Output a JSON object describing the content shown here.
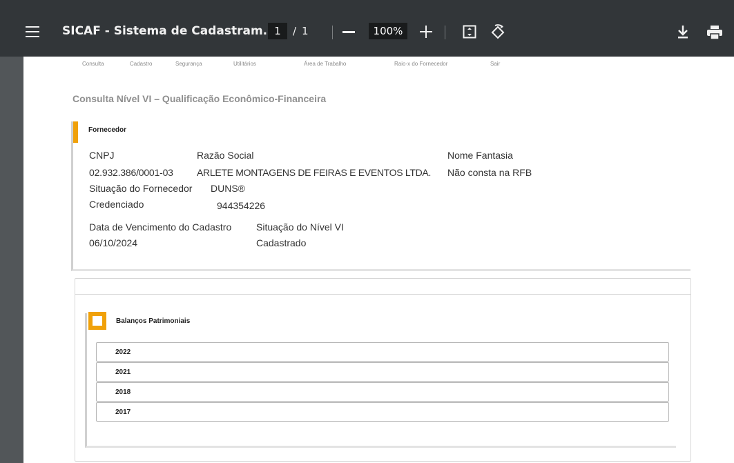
{
  "toolbar": {
    "title": "SICAF - Sistema de Cadastram...",
    "page_current": "1",
    "page_separator": "/",
    "page_total": "1",
    "zoom": "100%",
    "icons": [
      "menu-icon",
      "zoom-out-icon",
      "zoom-in-icon",
      "fit-page-icon",
      "rotate-icon",
      "download-icon",
      "print-icon"
    ]
  },
  "nav": [
    "Consulta",
    "Cadastro",
    "Segurança",
    "Utilitários",
    "Área de Trabalho",
    "Raio-x do Fornecedor",
    "Sair"
  ],
  "heading": "Consulta Nível VI – Qualificação Econômico-Financeira",
  "fornecedor": {
    "header": "Fornecedor",
    "cnpj_label": "CNPJ",
    "cnpj": "02.932.386/0001-03",
    "razao_label": "Razão Social",
    "razao": "ARLETE MONTAGENS DE FEIRAS E EVENTOS LTDA.",
    "fantasia_label": "Nome Fantasia",
    "fantasia": "Não consta na RFB",
    "situacao_label": "Situação do Fornecedor",
    "situacao": "Credenciado",
    "duns_label": "DUNS®",
    "duns": "944354226",
    "vencimento_label": "Data de Vencimento do Cadastro",
    "vencimento": "06/10/2024",
    "nivel_label": "Situação do Nível VI",
    "nivel": "Cadastrado"
  },
  "balancos": {
    "header": "Balanços Patrimoniais",
    "years": [
      "2022",
      "2021",
      "2018",
      "2017"
    ]
  },
  "colors": {
    "accent": "#f0a10a",
    "toolbar_bg": "#323639",
    "viewer_bg": "#525659"
  }
}
